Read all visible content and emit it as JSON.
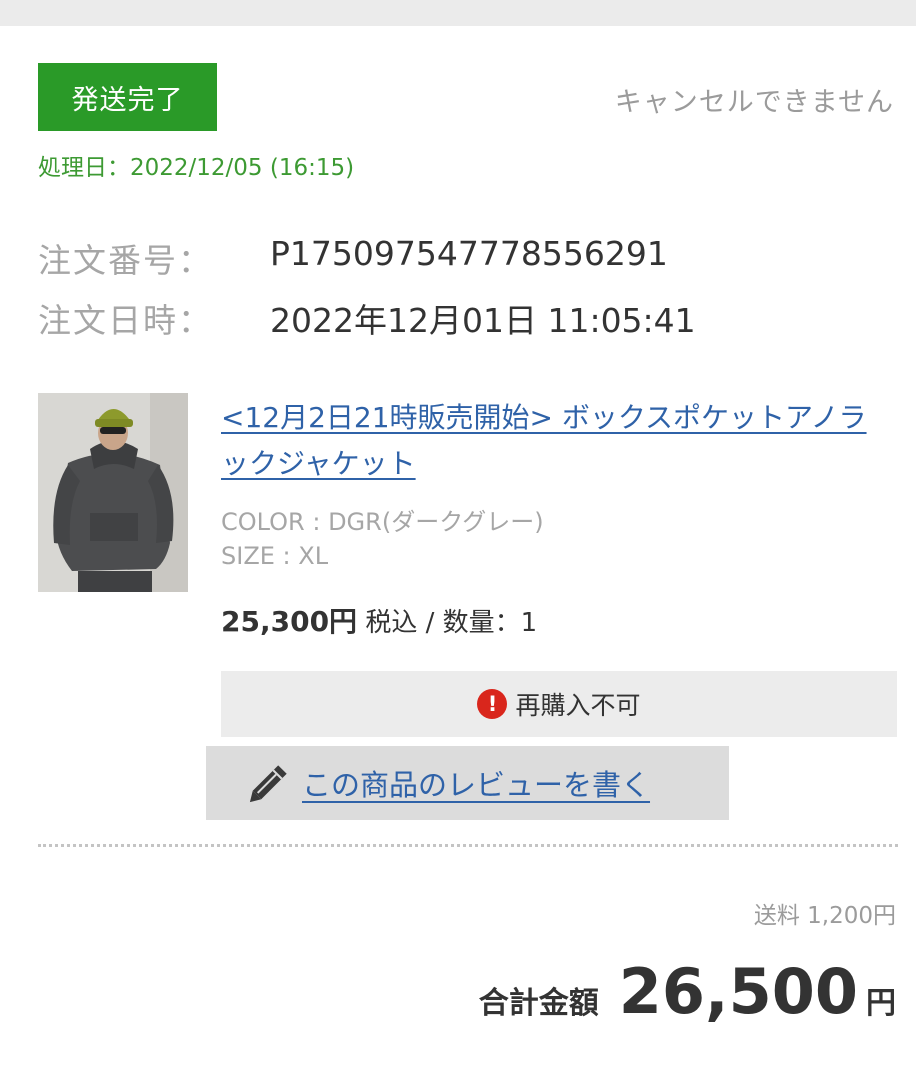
{
  "order": {
    "status_badge": "発送完了",
    "status_color": "#2a9a28",
    "cancel_note": "キャンセルできません",
    "process_date": "処理日：2022/12/05 (16:15)",
    "number_label": "注文番号：",
    "number_value": "P175097547778556291",
    "date_label": "注文日時：",
    "date_value": "2022年12月01日 11:05:41"
  },
  "product": {
    "image_icon": "product-photo-jacket",
    "title": "<12月2日21時販売開始> ボックスポケットアノラックジャケット",
    "color": "COLOR : DGR(ダークグレー)",
    "size": "SIZE : XL",
    "price": "25,300円",
    "price_note": " 税込 / 数量：1",
    "no_rebuy_icon": "alert-icon",
    "no_rebuy": "再購入不可",
    "review_icon": "pencil-icon",
    "review_label": "この商品のレビューを書く",
    "link_color": "#2f62a8"
  },
  "summary": {
    "shipping": "送料 1,200円",
    "total_label": "合計金額",
    "total_value": "26,500",
    "total_unit": "円"
  }
}
